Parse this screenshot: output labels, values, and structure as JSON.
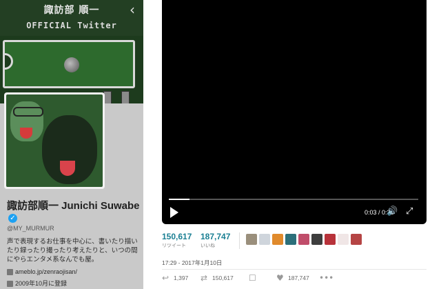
{
  "profile": {
    "header_title": "諏訪部 順一",
    "header_subtitle": "OFFICIAL Twitter",
    "back_icon": "chevron-left-icon",
    "display_name": "諏訪部順一 Junichi Suwabe",
    "handle": "@MY_MURMUR",
    "bio": "声で表現するお仕事を中心に、書いたり描いたり録ったり撮ったり考えたりと、いつの間にやらエンタメ系なんでも屋。",
    "website": "ameblo.jp/zenraojisan/",
    "joined": "2009年10月に登録"
  },
  "video": {
    "time": "0:03 / 0:36",
    "progress_fraction": 0.083,
    "play_icon": "play-icon",
    "volume_icon": "volume-icon",
    "fullscreen_icon": "fullscreen-icon"
  },
  "stats": {
    "retweets_value": "150,617",
    "retweets_label": "リツイート",
    "likes_value": "187,747",
    "likes_label": "いいね"
  },
  "likers": [
    {
      "name": "liker-avatar-1",
      "color": "#9a8f7c"
    },
    {
      "name": "liker-avatar-2",
      "color": "#cfd5dc"
    },
    {
      "name": "liker-avatar-3",
      "color": "#e08a2c"
    },
    {
      "name": "liker-avatar-4",
      "color": "#2c6f7a"
    },
    {
      "name": "liker-avatar-5",
      "color": "#c04d6a"
    },
    {
      "name": "liker-avatar-6",
      "color": "#3e3e3e"
    },
    {
      "name": "liker-avatar-7",
      "color": "#b8323a"
    },
    {
      "name": "liker-avatar-8",
      "color": "#f0e6e6"
    },
    {
      "name": "liker-avatar-9",
      "color": "#b54444"
    }
  ],
  "timestamp": "17:29 - 2017年1月10日",
  "actions": {
    "reply_count": "1,397",
    "retweet_count": "150,617",
    "like_count": "187,747"
  },
  "colors": {
    "accent": "#1a7f93",
    "verified": "#1da1f2"
  }
}
